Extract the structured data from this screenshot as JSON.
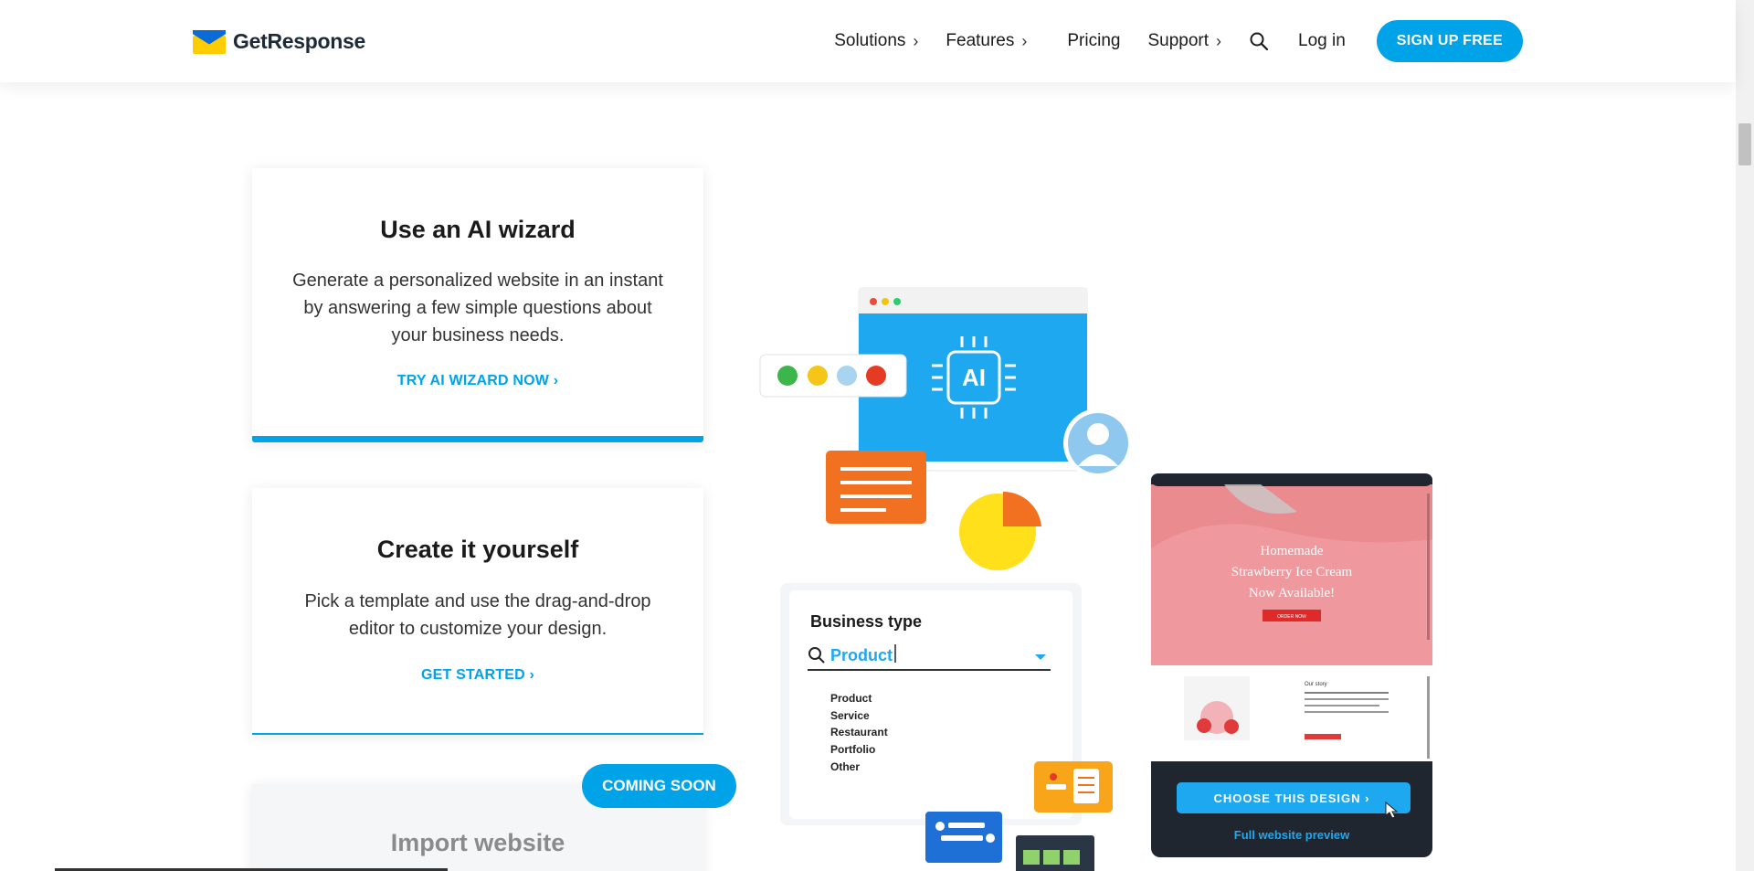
{
  "header": {
    "logo_text": "GetResponse",
    "nav": {
      "solutions": "Solutions",
      "features": "Features",
      "pricing": "Pricing",
      "support": "Support",
      "chevron": "›",
      "login": "Log in",
      "signup": "SIGN UP FREE"
    }
  },
  "cards": {
    "ai_wizard": {
      "title": "Use an AI wizard",
      "body_lines": [
        "Generate a personalized website in an instant",
        "by answering a few simple questions about",
        "your business needs."
      ],
      "link": "TRY AI WIZARD NOW ›"
    },
    "create": {
      "title": "Create it yourself",
      "body_lines": [
        "Pick a template and use the drag-and-drop",
        "editor to customize your design."
      ],
      "link": "GET STARTED ›"
    },
    "import": {
      "title": "Import website",
      "badge": "COMING SOON"
    }
  },
  "illustration": {
    "ai_chip_label": "AI",
    "business_type": {
      "title": "Business type",
      "selected": "Product",
      "options": [
        "Product",
        "Service",
        "Restaurant",
        "Portfolio",
        "Other"
      ]
    },
    "template_preview": {
      "hero_lines": [
        "Homemade",
        "Strawberry Ice Cream",
        "Now Available!"
      ],
      "hero_button": "ORDER NOW",
      "section_title": "Our story",
      "cta": "CHOOSE THIS DESIGN ›",
      "preview_link": "Full website preview"
    }
  },
  "colors": {
    "accent": "#00a2e8",
    "orange": "#f27121",
    "yellow": "#ffe01b",
    "dark": "#1e2a38"
  },
  "icons": [
    "search-icon",
    "chevron-right-icon",
    "ai-chip-icon",
    "user-avatar-icon",
    "pie-chart-icon",
    "cursor-hand-icon"
  ]
}
